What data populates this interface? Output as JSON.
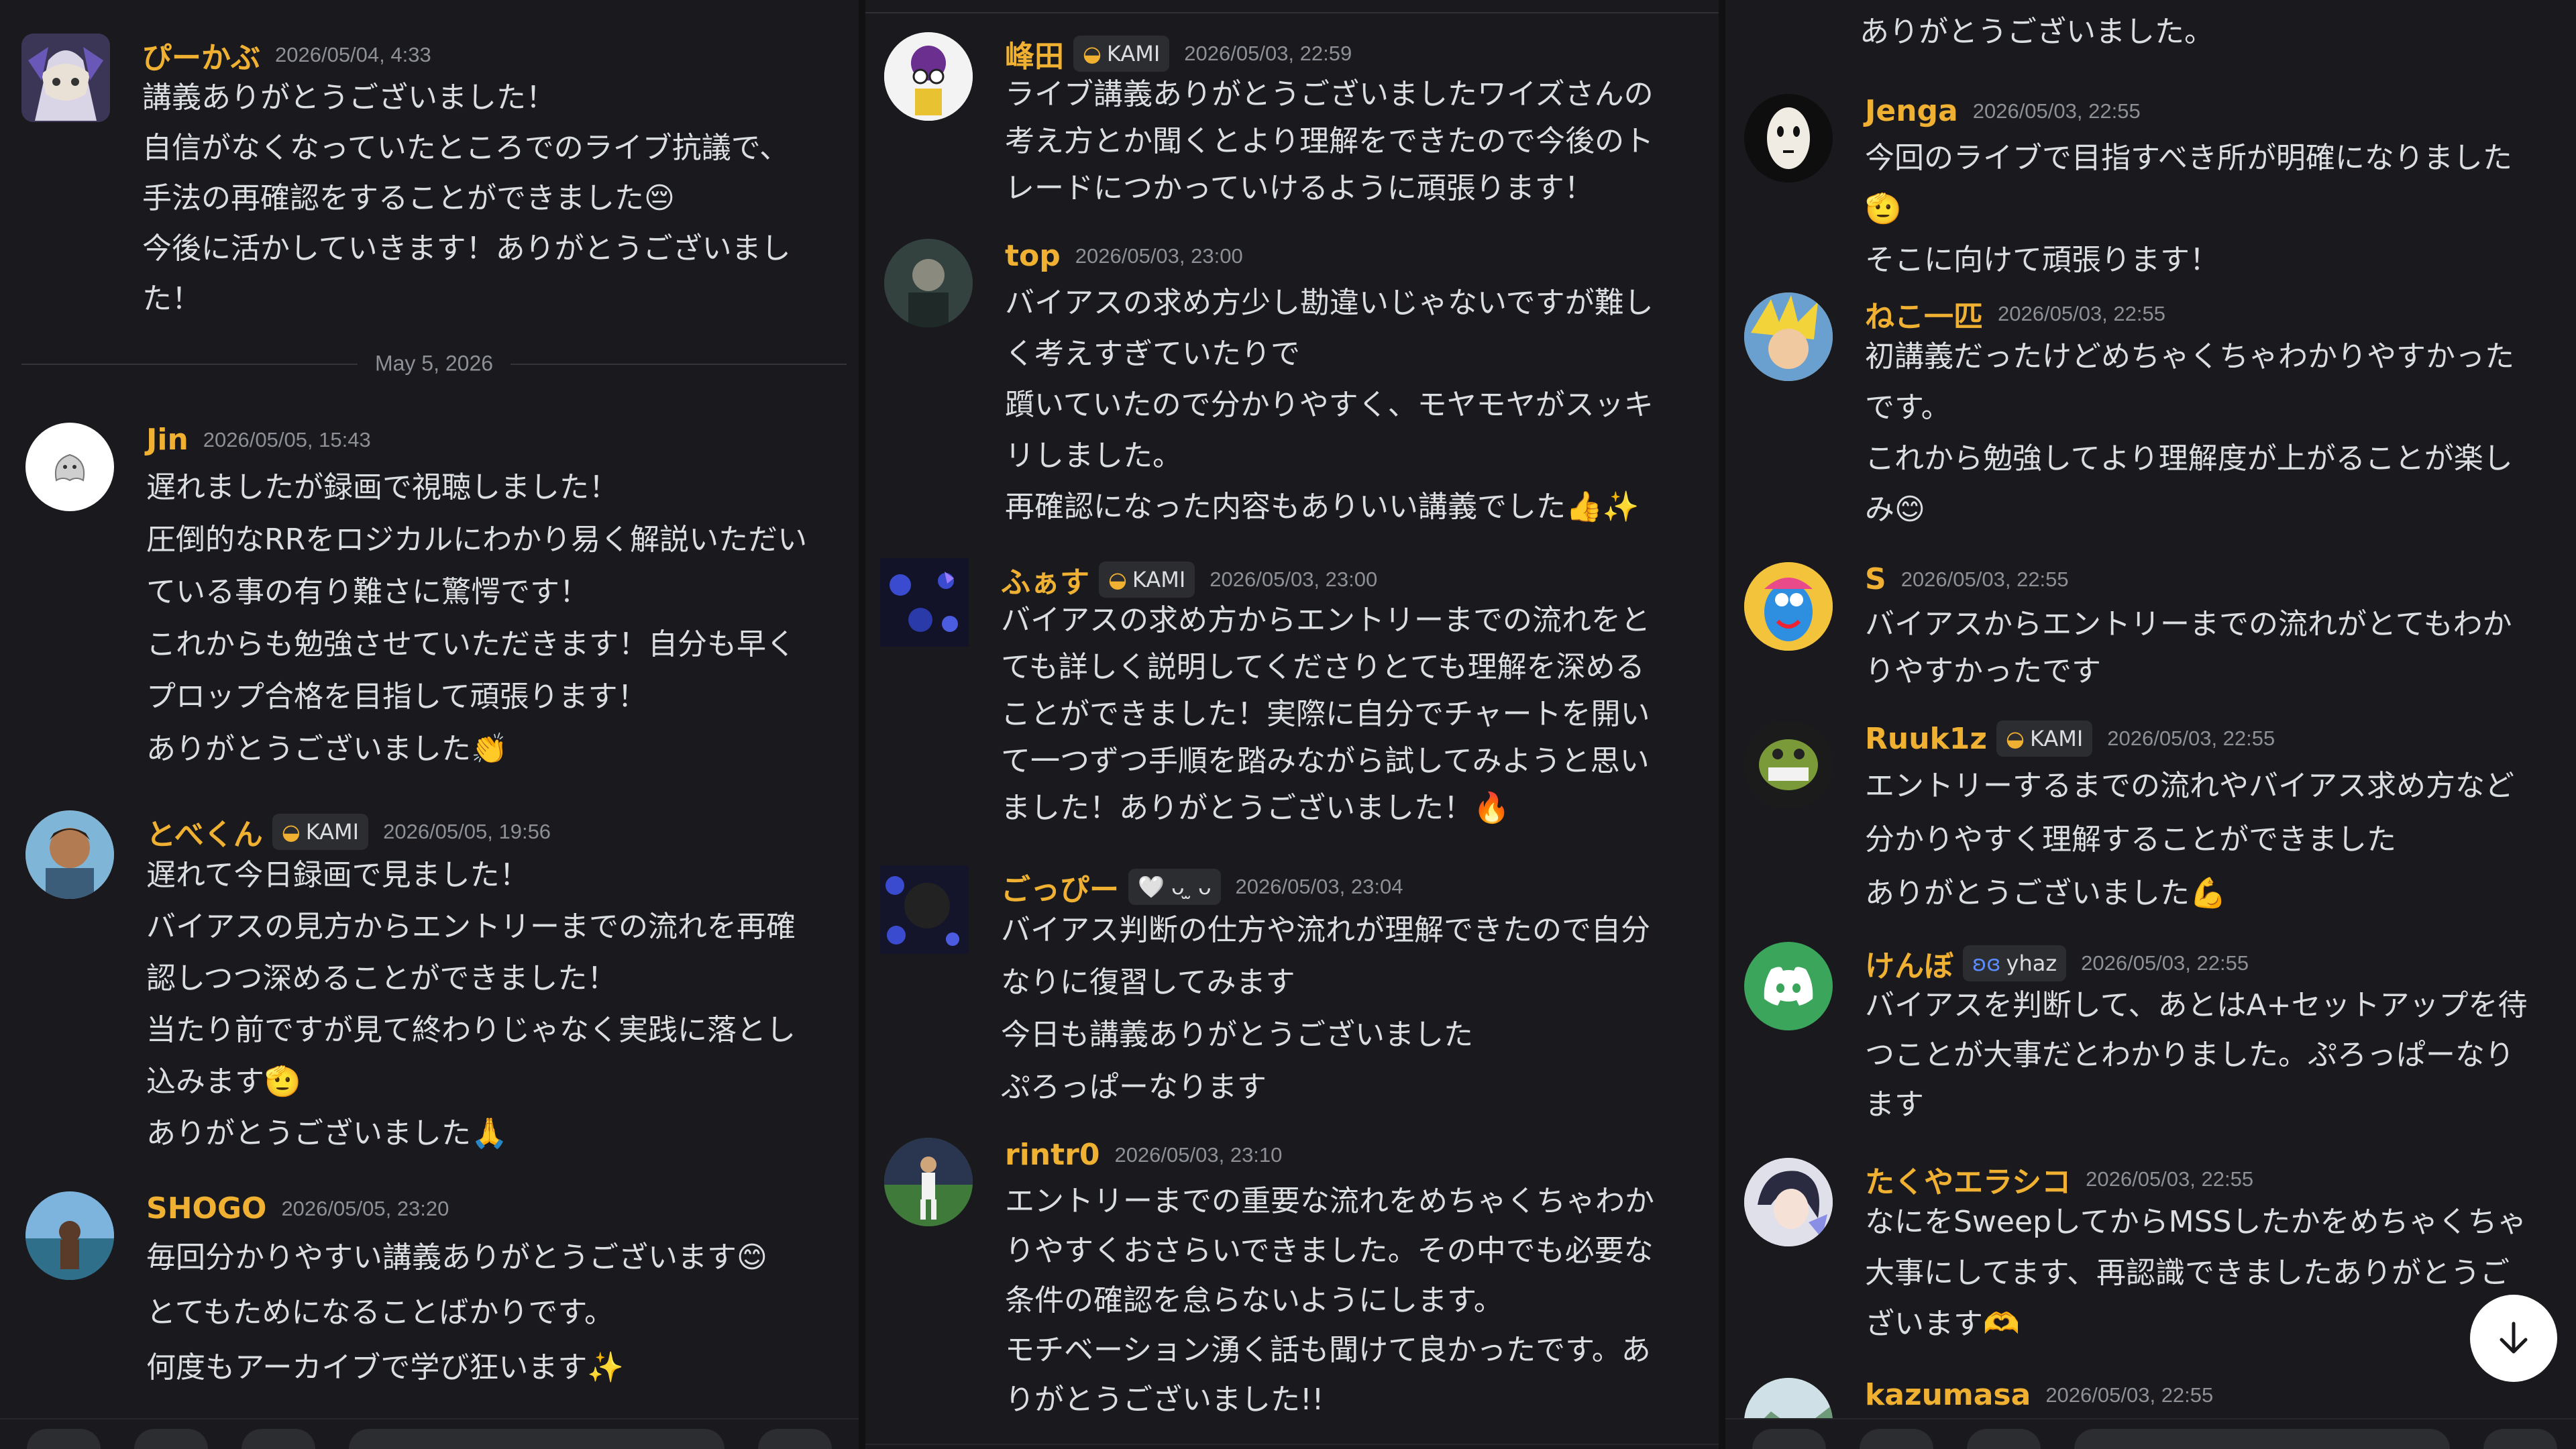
{
  "col1": {
    "m1": {
      "user": "ぴーかぶ",
      "time": "2026/05/04, 4:33",
      "lines": [
        "講義ありがとうございました！",
        "自信がなくなっていたところでのライブ抗議で、",
        "手法の再確認をすることができました😔",
        "今後に活かしていきます！ありがとうございまし",
        "た！"
      ]
    },
    "divider": "May 5, 2026",
    "m2": {
      "user": "Jin",
      "time": "2026/05/05, 15:43",
      "lines": [
        "遅れましたが録画で視聴しました！",
        "圧倒的なRRをロジカルにわかり易く解説いただい",
        "ている事の有り難さに驚愕です！",
        "これからも勉強させていただきます！自分も早く",
        "プロップ合格を目指して頑張ります！",
        "ありがとうございました👏"
      ]
    },
    "m3": {
      "user": "とべくん",
      "tag": "KAMI",
      "time": "2026/05/05, 19:56",
      "lines": [
        "遅れて今日録画で見ました！",
        "バイアスの見方からエントリーまでの流れを再確",
        "認しつつ深めることができました！",
        "当たり前ですが見て終わりじゃなく実践に落とし",
        "込みます🫡",
        "ありがとうございました🙏"
      ]
    },
    "m4": {
      "user": "SHOGO",
      "time": "2026/05/05, 23:20",
      "lines": [
        "毎回分かりやすい講義ありがとうございます😊",
        "とてもためになることばかりです。",
        "何度もアーカイブで学び狂います✨"
      ]
    }
  },
  "col2": {
    "m1": {
      "user": "峰田",
      "tag": "KAMI",
      "time": "2026/05/03, 22:59",
      "lines": [
        "ライブ講義ありがとうございましたワイズさんの",
        "考え方とか聞くとより理解をできたので今後のト",
        "レードにつかっていけるように頑張ります！"
      ]
    },
    "m2": {
      "user": "top",
      "time": "2026/05/03, 23:00",
      "lines": [
        "バイアスの求め方少し勘違いじゃないですが難し",
        "く考えすぎていたりで",
        "躓いていたので分かりやすく、モヤモヤがスッキ",
        "リしました。",
        "再確認になった内容もありいい講義でした👍✨"
      ]
    },
    "m3": {
      "user": "ふぁす",
      "tag": "KAMI",
      "time": "2026/05/03, 23:00",
      "lines": [
        "バイアスの求め方からエントリーまでの流れをと",
        "ても詳しく説明してくださりとても理解を深める",
        "ことができました！実際に自分でチャートを開い",
        "て一つずつ手順を踏みながら試してみようと思い",
        "ました！ありがとうございました！🔥"
      ]
    },
    "m4": {
      "user": "ごっぴー",
      "tag": "🤍 ᴗ ̫ ᴗ",
      "time": "2026/05/03, 23:04",
      "lines": [
        "バイアス判断の仕方や流れが理解できたので自分",
        "なりに復習してみます",
        "今日も講義ありがとうございました",
        "ぷろっぱーなります"
      ]
    },
    "m5": {
      "user": "rintr0",
      "time": "2026/05/03, 23:10",
      "lines": [
        "エントリーまでの重要な流れをめちゃくちゃわか",
        "りやすくおさらいできました。その中でも必要な",
        "条件の確認を怠らないようにします。",
        "モチベーション湧く話も聞けて良かったです。あ",
        "りがとうございました!!"
      ]
    }
  },
  "col3": {
    "top_line": "ありがとうございました。",
    "m1": {
      "user": "Jenga",
      "time": "2026/05/03, 22:55",
      "lines": [
        "今回のライブで目指すべき所が明確になりました",
        "🫡",
        "そこに向けて頑張ります！"
      ]
    },
    "m2": {
      "user": "ねこ一匹",
      "time": "2026/05/03, 22:55",
      "lines": [
        "初講義だったけどめちゃくちゃわかりやすかった",
        "です。",
        "これから勉強してより理解度が上がることが楽し",
        "み😊"
      ]
    },
    "m3": {
      "user": "S",
      "time": "2026/05/03, 22:55",
      "lines": [
        "バイアスからエントリーまでの流れがとてもわか",
        "りやすかったです"
      ]
    },
    "m4": {
      "user": "Ruuk1z",
      "tag": "KAMI",
      "time": "2026/05/03, 22:55",
      "lines": [
        "エントリーするまでの流れやバイアス求め方など",
        "分かりやすく理解することができました",
        "ありがとうございました💪"
      ]
    },
    "m5": {
      "user": "けんぼ",
      "tag": "yhaz",
      "time": "2026/05/03, 22:55",
      "lines": [
        "バイアスを判断して、あとはA+セットアップを待",
        "つことが大事だとわかりました。ぷろっぱーなり",
        "ます"
      ]
    },
    "m6": {
      "user": "たくやエラシコ",
      "time": "2026/05/03, 22:55",
      "lines": [
        "なにをSweepしてからMSSしたかをめちゃくちゃ",
        "大事にしてます、再認識できましたありがとうご",
        "ざいます🫶"
      ]
    },
    "m7": {
      "user": "kazumasa",
      "time": "2026/05/03, 22:55"
    }
  },
  "icons": {
    "scroll": "arrow-down-icon",
    "tag_badge": "kami-badge-icon"
  },
  "colors": {
    "username": "#f0b132",
    "background": "#1a1a1e",
    "text": "#dbdee1",
    "timestamp": "#8d9097"
  }
}
